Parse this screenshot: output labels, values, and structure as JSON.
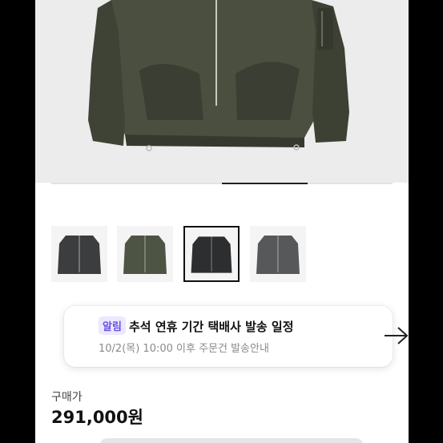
{
  "product_images": {
    "current_index": 2,
    "total": 4,
    "thumbnails": [
      {
        "name": "black-jacket-front",
        "color": "#3b3d3e"
      },
      {
        "name": "olive-jacket-front",
        "color": "#4e5444"
      },
      {
        "name": "black-jacket-alt",
        "color": "#2c2e30"
      },
      {
        "name": "charcoal-jacket-front",
        "color": "#56585a"
      }
    ]
  },
  "notice": {
    "badge": "알림",
    "title": "추석 연휴 기간 택배사 발송 일정",
    "subtitle": "10/2(목) 10:00 이후 주문건 발송안내",
    "arrow_icon": "arrow-right-icon"
  },
  "price": {
    "label": "구매가",
    "value": "291,000원"
  },
  "colors": {
    "accent": "#6a4fe4",
    "badge_bg": "#ece8ff"
  }
}
